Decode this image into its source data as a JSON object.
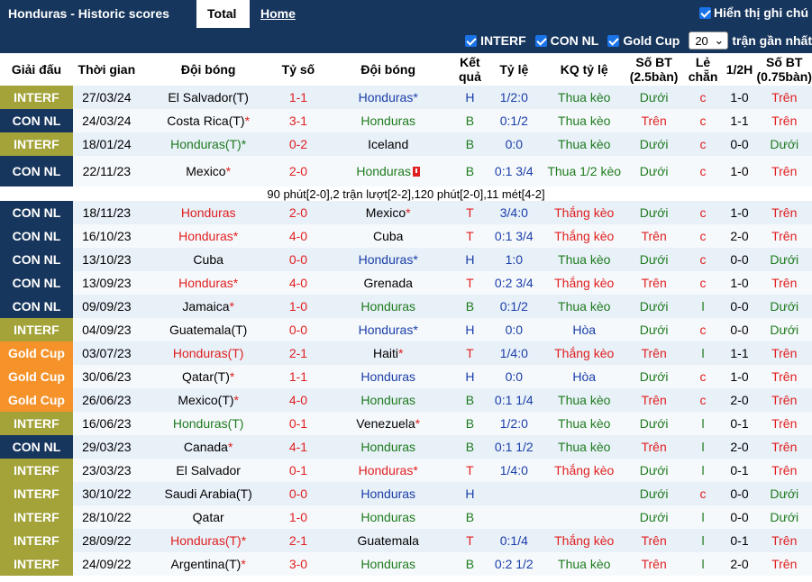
{
  "header": {
    "title": "Honduras - Historic scores",
    "tabs": [
      "Total",
      "Home"
    ],
    "show_notes_label": "Hiển thị ghi chú"
  },
  "filters": {
    "items": [
      "INTERF",
      "CON NL",
      "Gold Cup"
    ],
    "count": "20",
    "recent_label": "trận gần nhất"
  },
  "columns": [
    "Giải đấu",
    "Thời gian",
    "Đội bóng",
    "Tỷ số",
    "Đội bóng",
    "Kết quả",
    "Tỷ lệ",
    "KQ tỷ lệ",
    "Số BT (2.5bàn)",
    "Lẻ chẵn",
    "1/2H",
    "Số BT (0.75bàn)"
  ],
  "colors": {
    "INTERF": "#a3a33a",
    "CON NL": "#17365d",
    "Gold Cup": "#f5922a",
    "red": "#e02020",
    "blue": "#1a3ea8",
    "green": "#1e7b1e"
  },
  "rows": [
    {
      "comp": "INTERF",
      "date": "27/03/24",
      "home": "El Salvador(T)",
      "hc": "k",
      "score": "1-1",
      "away": "Honduras*",
      "ac": "b",
      "res": "H",
      "odds": "1/2:0",
      "kq": "Thua kèo",
      "bt": "Dưới",
      "lc": "c",
      "h": "1-0",
      "bt2": "Trên"
    },
    {
      "comp": "CON NL",
      "date": "24/03/24",
      "home": "Costa Rica(T)*",
      "hc": "k",
      "score": "3-1",
      "away": "Honduras",
      "ac": "g",
      "res": "B",
      "odds": "0:1/2",
      "kq": "Thua kèo",
      "bt": "Trên",
      "lc": "c",
      "h": "1-1",
      "bt2": "Trên"
    },
    {
      "comp": "INTERF",
      "date": "18/01/24",
      "home": "Honduras(T)*",
      "hc": "g",
      "score": "0-2",
      "away": "Iceland",
      "ac": "k",
      "res": "B",
      "odds": "0:0",
      "kq": "Thua kèo",
      "bt": "Dưới",
      "lc": "c",
      "h": "0-0",
      "bt2": "Dưới"
    },
    {
      "comp": "CON NL",
      "date": "22/11/23",
      "home": "Mexico*",
      "hc": "k",
      "score": "2-0",
      "away": "Honduras",
      "ac": "g",
      "res": "B",
      "odds": "0:1 3/4",
      "kq": "Thua 1/2 kèo",
      "bt": "Dưới",
      "lc": "c",
      "h": "1-0",
      "bt2": "Trên",
      "tall": true,
      "card": true
    },
    {
      "note": "90 phút[2-0],2 trận lượt[2-2],120 phút[2-0],11 mét[4-2]"
    },
    {
      "comp": "CON NL",
      "date": "18/11/23",
      "home": "Honduras",
      "hc": "r",
      "score": "2-0",
      "away": "Mexico*",
      "ac": "k",
      "res": "T",
      "odds": "3/4:0",
      "kq": "Thắng kèo",
      "bt": "Dưới",
      "lc": "c",
      "h": "1-0",
      "bt2": "Trên"
    },
    {
      "comp": "CON NL",
      "date": "16/10/23",
      "home": "Honduras*",
      "hc": "r",
      "score": "4-0",
      "away": "Cuba",
      "ac": "k",
      "res": "T",
      "odds": "0:1 3/4",
      "kq": "Thắng kèo",
      "bt": "Trên",
      "lc": "c",
      "h": "2-0",
      "bt2": "Trên"
    },
    {
      "comp": "CON NL",
      "date": "13/10/23",
      "home": "Cuba",
      "hc": "k",
      "score": "0-0",
      "away": "Honduras*",
      "ac": "b",
      "res": "H",
      "odds": "1:0",
      "kq": "Thua kèo",
      "bt": "Dưới",
      "lc": "c",
      "h": "0-0",
      "bt2": "Dưới"
    },
    {
      "comp": "CON NL",
      "date": "13/09/23",
      "home": "Honduras*",
      "hc": "r",
      "score": "4-0",
      "away": "Grenada",
      "ac": "k",
      "res": "T",
      "odds": "0:2 3/4",
      "kq": "Thắng kèo",
      "bt": "Trên",
      "lc": "c",
      "h": "1-0",
      "bt2": "Trên"
    },
    {
      "comp": "CON NL",
      "date": "09/09/23",
      "home": "Jamaica*",
      "hc": "k",
      "score": "1-0",
      "away": "Honduras",
      "ac": "g",
      "res": "B",
      "odds": "0:1/2",
      "kq": "Thua kèo",
      "bt": "Dưới",
      "lc": "l",
      "h": "0-0",
      "bt2": "Dưới"
    },
    {
      "comp": "INTERF",
      "date": "04/09/23",
      "home": "Guatemala(T)",
      "hc": "k",
      "score": "0-0",
      "away": "Honduras*",
      "ac": "b",
      "res": "H",
      "odds": "0:0",
      "kq": "Hòa",
      "bt": "Dưới",
      "lc": "c",
      "h": "0-0",
      "bt2": "Dưới"
    },
    {
      "comp": "Gold Cup",
      "date": "03/07/23",
      "home": "Honduras(T)",
      "hc": "r",
      "score": "2-1",
      "away": "Haiti*",
      "ac": "k",
      "res": "T",
      "odds": "1/4:0",
      "kq": "Thắng kèo",
      "bt": "Trên",
      "lc": "l",
      "h": "1-1",
      "bt2": "Trên"
    },
    {
      "comp": "Gold Cup",
      "date": "30/06/23",
      "home": "Qatar(T)*",
      "hc": "k",
      "score": "1-1",
      "away": "Honduras",
      "ac": "b",
      "res": "H",
      "odds": "0:0",
      "kq": "Hòa",
      "bt": "Dưới",
      "lc": "c",
      "h": "1-0",
      "bt2": "Trên"
    },
    {
      "comp": "Gold Cup",
      "date": "26/06/23",
      "home": "Mexico(T)*",
      "hc": "k",
      "score": "4-0",
      "away": "Honduras",
      "ac": "g",
      "res": "B",
      "odds": "0:1 1/4",
      "kq": "Thua kèo",
      "bt": "Trên",
      "lc": "c",
      "h": "2-0",
      "bt2": "Trên"
    },
    {
      "comp": "INTERF",
      "date": "16/06/23",
      "home": "Honduras(T)",
      "hc": "g",
      "score": "0-1",
      "away": "Venezuela*",
      "ac": "k",
      "res": "B",
      "odds": "1/2:0",
      "kq": "Thua kèo",
      "bt": "Dưới",
      "lc": "l",
      "h": "0-1",
      "bt2": "Trên"
    },
    {
      "comp": "CON NL",
      "date": "29/03/23",
      "home": "Canada*",
      "hc": "k",
      "score": "4-1",
      "away": "Honduras",
      "ac": "g",
      "res": "B",
      "odds": "0:1 1/2",
      "kq": "Thua kèo",
      "bt": "Trên",
      "lc": "l",
      "h": "2-0",
      "bt2": "Trên"
    },
    {
      "comp": "INTERF",
      "date": "23/03/23",
      "home": "El Salvador",
      "hc": "k",
      "score": "0-1",
      "away": "Honduras*",
      "ac": "r",
      "res": "T",
      "odds": "1/4:0",
      "kq": "Thắng kèo",
      "bt": "Dưới",
      "lc": "l",
      "h": "0-1",
      "bt2": "Trên"
    },
    {
      "comp": "INTERF",
      "date": "30/10/22",
      "home": "Saudi Arabia(T)",
      "hc": "k",
      "score": "0-0",
      "away": "Honduras",
      "ac": "b",
      "res": "H",
      "odds": "",
      "kq": "",
      "bt": "Dưới",
      "lc": "c",
      "h": "0-0",
      "bt2": "Dưới"
    },
    {
      "comp": "INTERF",
      "date": "28/10/22",
      "home": "Qatar",
      "hc": "k",
      "score": "1-0",
      "away": "Honduras",
      "ac": "g",
      "res": "B",
      "odds": "",
      "kq": "",
      "bt": "Dưới",
      "lc": "l",
      "h": "0-0",
      "bt2": "Dưới"
    },
    {
      "comp": "INTERF",
      "date": "28/09/22",
      "home": "Honduras(T)*",
      "hc": "r",
      "score": "2-1",
      "away": "Guatemala",
      "ac": "k",
      "res": "T",
      "odds": "0:1/4",
      "kq": "Thắng kèo",
      "bt": "Trên",
      "lc": "l",
      "h": "0-1",
      "bt2": "Trên"
    },
    {
      "comp": "INTERF",
      "date": "24/09/22",
      "home": "Argentina(T)*",
      "hc": "k",
      "score": "3-0",
      "away": "Honduras",
      "ac": "g",
      "res": "B",
      "odds": "0:2 1/2",
      "kq": "Thua kèo",
      "bt": "Trên",
      "lc": "l",
      "h": "2-0",
      "bt2": "Trên"
    }
  ]
}
